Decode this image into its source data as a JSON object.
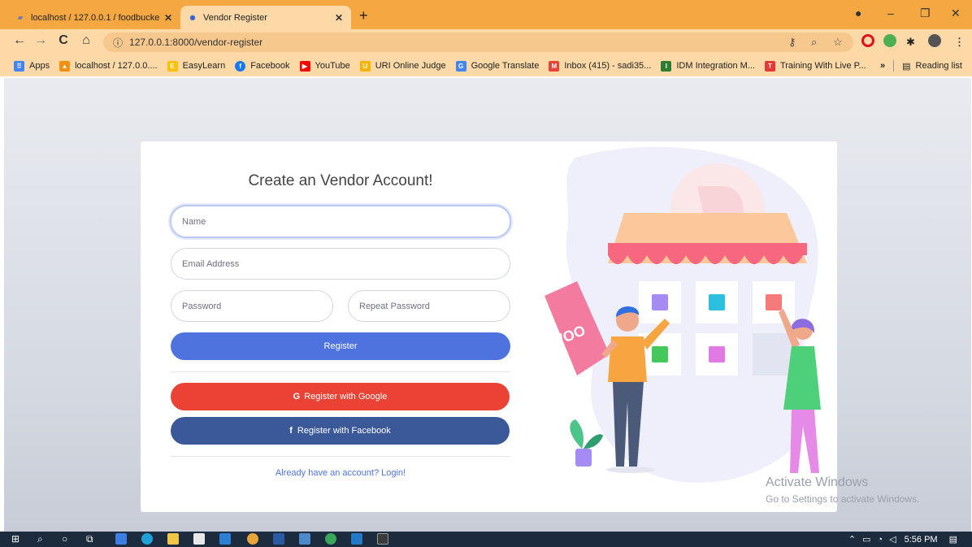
{
  "browser": {
    "tabs": [
      {
        "title": "localhost / 127.0.0.1 / foodbucke",
        "favicon": "phpmyadmin-icon",
        "active": false
      },
      {
        "title": "Vendor Register",
        "favicon": "vendor-site-icon",
        "active": true
      }
    ],
    "address": "127.0.0.1:8000/vendor-register",
    "bookmarks": [
      {
        "label": "Apps",
        "icon": "apps-grid-icon",
        "color": "#4285f4"
      },
      {
        "label": "localhost / 127.0.0....",
        "icon": "phpmyadmin-icon",
        "color": "#f29111"
      },
      {
        "label": "EasyLearn",
        "icon": "easylearn-icon",
        "color": "#ffc107"
      },
      {
        "label": "Facebook",
        "icon": "facebook-icon",
        "color": "#1877f2"
      },
      {
        "label": "YouTube",
        "icon": "youtube-icon",
        "color": "#ff0000"
      },
      {
        "label": "URI Online Judge",
        "icon": "uri-icon",
        "color": "#f4b400"
      },
      {
        "label": "Google Translate",
        "icon": "translate-icon",
        "color": "#4285f4"
      },
      {
        "label": "Inbox (415) - sadi35...",
        "icon": "gmail-icon",
        "color": "#ea4335"
      },
      {
        "label": "IDM Integration M...",
        "icon": "idm-icon",
        "color": "#2e7d32"
      },
      {
        "label": "Training With Live P...",
        "icon": "training-icon",
        "color": "#e53935"
      }
    ],
    "overflow": "»",
    "reading_list": "Reading list"
  },
  "form": {
    "heading": "Create an Vendor Account!",
    "name_placeholder": "Name",
    "email_placeholder": "Email Address",
    "password_placeholder": "Password",
    "repeat_placeholder": "Repeat Password",
    "register_label": "Register",
    "google_label": "Register with Google",
    "facebook_label": "Register with Facebook",
    "login_link": "Already have an account? Login!"
  },
  "illustration": {
    "badge_text": "WOO"
  },
  "watermark": {
    "line1": "Activate Windows",
    "line2": "Go to Settings to activate Windows."
  },
  "taskbar": {
    "time": "5:56 PM"
  },
  "colors": {
    "tab_bar": "#f5a742",
    "toolbar": "#fcd9a7",
    "primary": "#4e73df",
    "google": "#ea4335",
    "facebook": "#3b5998"
  }
}
